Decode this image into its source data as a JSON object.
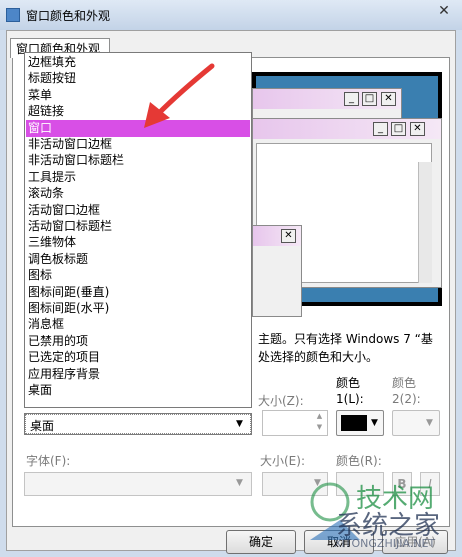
{
  "window": {
    "title": "窗口颜色和外观",
    "close_glyph": "✕"
  },
  "tab": {
    "label": "窗口颜色和外观"
  },
  "item_list": {
    "items": [
      "边框填充",
      "标题按钮",
      "菜单",
      "超链接",
      "窗口",
      "非活动窗口边框",
      "非活动窗口标题栏",
      "工具提示",
      "滚动条",
      "活动窗口边框",
      "活动窗口标题栏",
      "三维物体",
      "调色板标题",
      "图标",
      "图标间距(垂直)",
      "图标间距(水平)",
      "消息框",
      "已禁用的项",
      "已选定的项目",
      "应用程序背景",
      "桌面"
    ],
    "selected": "窗口",
    "highlight_color": "#d84fe6"
  },
  "item_combo": {
    "value": "桌面"
  },
  "description": {
    "line1": "主题。只有选择 Windows 7 “基",
    "line2": "处选择的颜色和大小。"
  },
  "size_label": "大小(Z):",
  "color1": {
    "label": "颜色",
    "sub_label": "1(L):",
    "value": "#000000"
  },
  "color2": {
    "label": "颜色",
    "sub_label": "2(2):"
  },
  "font_label": "字体(F):",
  "font_size_label": "大小(E):",
  "font_color_label": "颜色(R):",
  "bold_glyph": "B",
  "italic_glyph": "I",
  "buttons": {
    "ok": "确定",
    "cancel": "取消",
    "apply": "应用(A)"
  },
  "preview": {
    "window_buttons": [
      "_",
      "□",
      "✕"
    ]
  },
  "watermark": {
    "line1": "技术网",
    "line2": "系统之家",
    "line3": "XITONGZHIJIA.NET"
  },
  "colors": {
    "arrow": "#e53935",
    "preview_title": "#e7c6ec",
    "selected_item": "#d84fe6"
  }
}
